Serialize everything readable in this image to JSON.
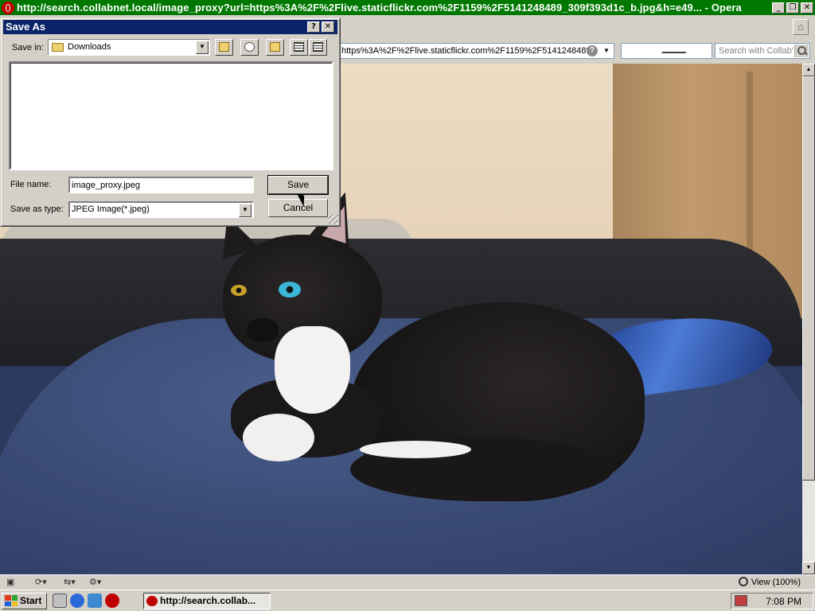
{
  "browser": {
    "title": "http://search.collabnet.local/image_proxy?url=https%3A%2F%2Flive.staticflickr.com%2F1159%2F5141248489_309f393d1c_b.jpg&h=e49... - Opera",
    "caption_buttons": [
      "_",
      "❐",
      "✕"
    ],
    "address_value": "https%3A%2F%2Flive.staticflickr.com%2F1159%2F5141248489",
    "address_help": "?",
    "search_placeholder": "Search with Collab'",
    "zoom": "View (100%)"
  },
  "dialog": {
    "title": "Save As",
    "title_buttons": [
      "?",
      "✕"
    ],
    "save_in_label": "Save in:",
    "save_in_value": "Downloads",
    "file_name_label": "File name:",
    "file_name_value": "image_proxy.jpeg",
    "save_as_type_label": "Save as type:",
    "save_as_type_value": "JPEG Image(*.jpeg)",
    "save_button": "Save",
    "cancel_button": "Cancel"
  },
  "taskbar": {
    "start_label": "Start",
    "task_label": "http://search.collab...",
    "clock": "7:08 PM"
  },
  "colors": {
    "title_bar": "#007800",
    "dialog_title": "#0a246a",
    "chrome": "#d4d0c8"
  }
}
